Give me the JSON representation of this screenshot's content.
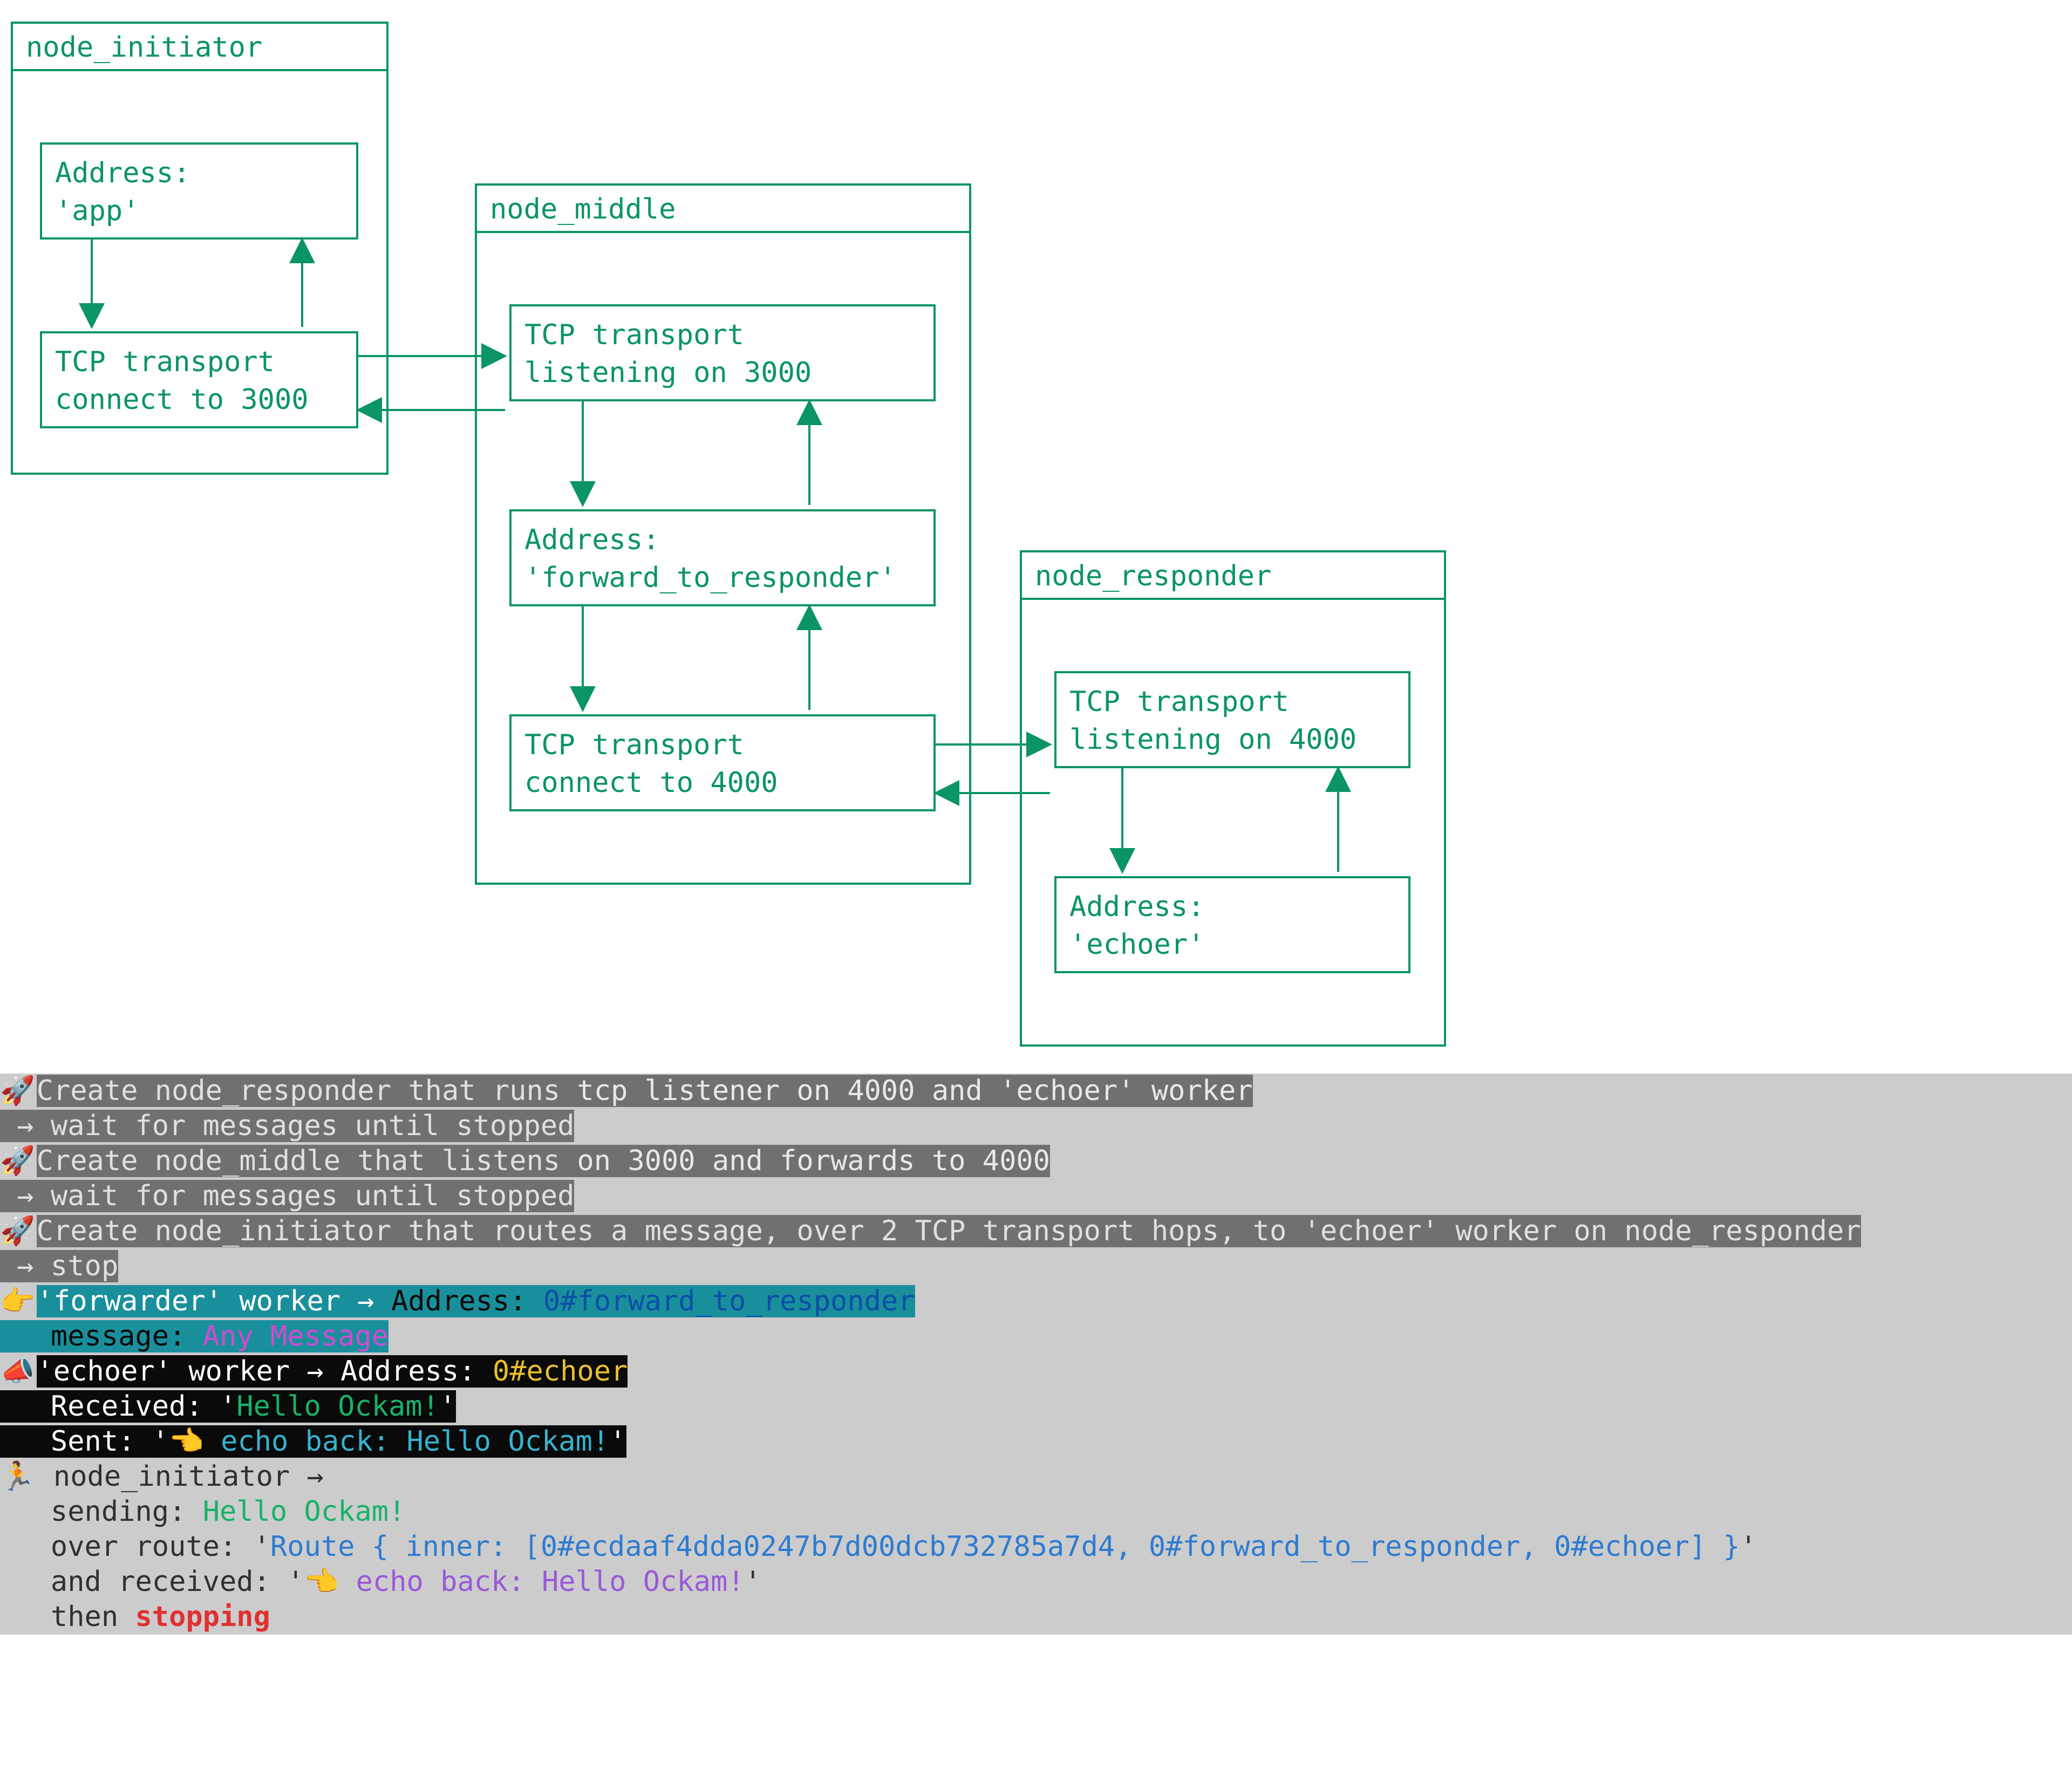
{
  "diagram": {
    "nodes": {
      "initiator": {
        "title": "node_initiator",
        "box_app": "Address:\n'app'",
        "box_tcp": "TCP transport\nconnect to 3000"
      },
      "middle": {
        "title": "node_middle",
        "box_listen": "TCP transport\nlistening on 3000",
        "box_fwd": "Address:\n'forward_to_responder'",
        "box_tcp": "TCP transport\nconnect to 4000"
      },
      "responder": {
        "title": "node_responder",
        "box_listen": "TCP transport\nlistening on 4000",
        "box_echo": "Address:\n'echoer'"
      }
    }
  },
  "term": {
    "l1a": "Create node_responder that runs ",
    "l1b": "tcp listener on 4000 and 'echoer' worker",
    "l2": " → wait for messages until stopped",
    "l3a": "Create node_middle that listens ",
    "l3b": "on 3000 and forwards to 4000",
    "l4": " → wait for messages until stopped",
    "l5": "Create node_initiator that routes a message, over 2 TCP transport hops, to 'echoer' worker on node_responder",
    "l6": " → stop",
    "l7a": "'forwarder' worker → ",
    "l7b": "Address: ",
    "l7c": "0#forward_to_responder",
    "l8a": "   message: ",
    "l8b": "Any Message",
    "l9a": "'echoer' worker → ",
    "l9b": "Address: ",
    "l9c": "0#echoer",
    "l10a": "   Received: '",
    "l10b": "Hello Ockam!",
    "l10c": "'",
    "l11a": "   Sent: '",
    "l11b": "👈 echo back: Hello Ockam!",
    "l11c": "'",
    "l12": " node_initiator →",
    "l13a": "   sending: ",
    "l13b": "Hello Ockam!",
    "l14a": "   over route: '",
    "l14b": "Route { inner: [0#ecdaaf4dda0247b7d00dcb732785a7d4, 0#forward_to_responder, 0#echoer] }",
    "l14c": "'",
    "l15a": "   and received: '",
    "l15b": "👈 echo back: Hello Ockam!",
    "l15c": "'",
    "l16a": "   then ",
    "l16b": "stopping"
  },
  "emoji": {
    "rocket": "🚀",
    "point": "👉",
    "mega": "📣",
    "runner": "🏃"
  }
}
